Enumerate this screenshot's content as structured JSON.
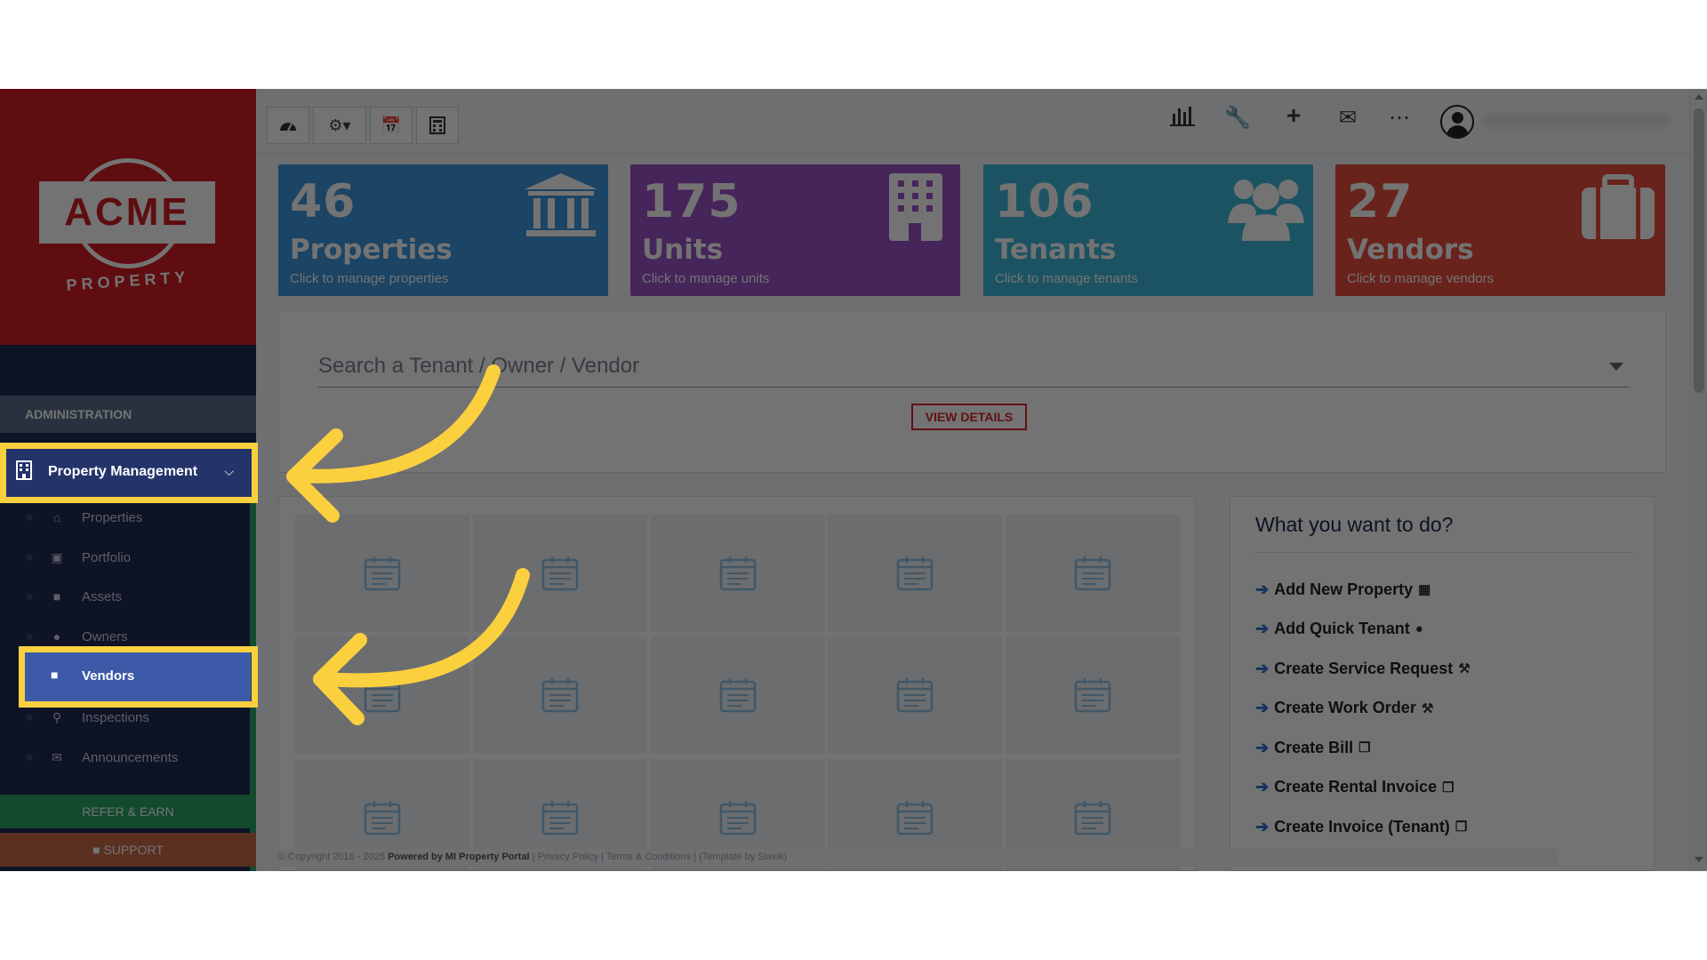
{
  "sidebar": {
    "logo_text": "ACME",
    "logo_sub": "PROPERTY",
    "section_header": "ADMINISTRATION",
    "menu_parent": "Property Management",
    "items": [
      {
        "label": "Properties",
        "icon": "home-icon"
      },
      {
        "label": "Portfolio",
        "icon": "portfolio-icon"
      },
      {
        "label": "Assets",
        "icon": "assets-icon"
      },
      {
        "label": "Owners",
        "icon": "user-icon"
      },
      {
        "label": "Vendors",
        "icon": "briefcase-icon"
      },
      {
        "label": "Inspections",
        "icon": "search-icon"
      },
      {
        "label": "Announcements",
        "icon": "megaphone-icon"
      }
    ],
    "refer": "REFER & EARN",
    "support": "SUPPORT"
  },
  "toolbar": {
    "left_buttons": [
      "dashboard-icon",
      "gear-dropdown-icon",
      "calendar-check-icon",
      "calculator-icon"
    ],
    "right_icons": [
      "bar-chart-icon",
      "wrench-icon",
      "plus-icon",
      "envelope-icon",
      "more-icon",
      "user-avatar-icon"
    ]
  },
  "stats": [
    {
      "value": "46",
      "title": "Properties",
      "subtitle": "Click to manage properties",
      "color": "#3d97e0",
      "icon": "bank-icon"
    },
    {
      "value": "175",
      "title": "Units",
      "subtitle": "Click to manage units",
      "color": "#9b52c8",
      "icon": "building-icon"
    },
    {
      "value": "106",
      "title": "Tenants",
      "subtitle": "Click to manage tenants",
      "color": "#3fb9dc",
      "icon": "users-icon"
    },
    {
      "value": "27",
      "title": "Vendors",
      "subtitle": "Click to manage vendors",
      "color": "#e94f3f",
      "icon": "briefcase-icon"
    }
  ],
  "search": {
    "placeholder": "Search a Tenant / Owner / Vendor",
    "button": "VIEW DETAILS"
  },
  "todo": {
    "title": "What you want to do?",
    "items": [
      {
        "label": "Add New Property",
        "icon": "building-icon"
      },
      {
        "label": "Add Quick Tenant",
        "icon": "user-icon"
      },
      {
        "label": "Create Service Request",
        "icon": "wrench-icon"
      },
      {
        "label": "Create Work Order",
        "icon": "wrench-icon"
      },
      {
        "label": "Create Bill",
        "icon": "copy-icon"
      },
      {
        "label": "Create Rental Invoice",
        "icon": "copy-icon"
      },
      {
        "label": "Create Invoice (Tenant)",
        "icon": "copy-icon"
      }
    ]
  },
  "footer": {
    "copyright": "© Copyright 2016 - 2025",
    "powered": "Powered by MI Property Portal",
    "privacy": "Privacy Policy",
    "terms": "Terms & Conditions",
    "template": "(Template by Slavik)"
  },
  "colors": {
    "highlight": "#fbd03f",
    "sidebar_bg": "#1f2a52",
    "logo_bg": "#d31d26"
  }
}
